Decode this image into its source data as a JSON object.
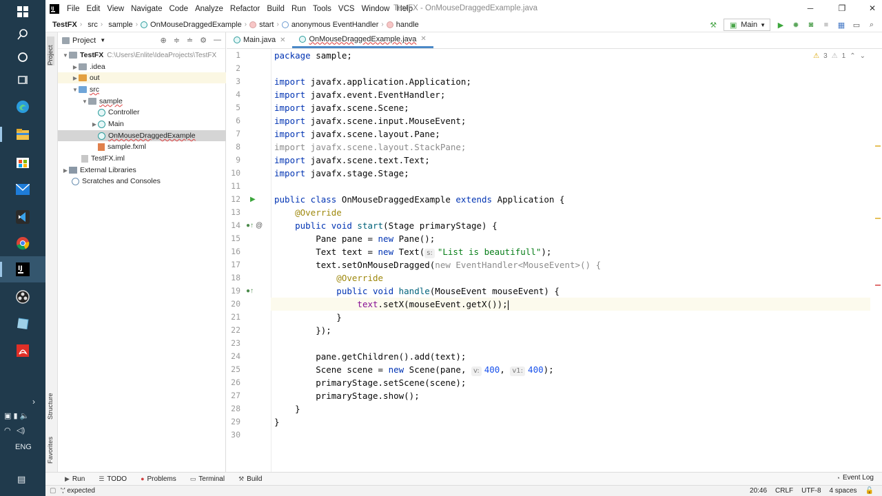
{
  "taskbar": {
    "language": "ENG"
  },
  "menu": {
    "items": [
      "File",
      "Edit",
      "View",
      "Navigate",
      "Code",
      "Analyze",
      "Refactor",
      "Build",
      "Run",
      "Tools",
      "VCS",
      "Window",
      "Help"
    ],
    "window_title": "TestFX - OnMouseDraggedExample.java"
  },
  "navbar": {
    "crumbs": [
      "TestFX",
      "src",
      "sample",
      "OnMouseDraggedExample",
      "start",
      "anonymous EventHandler",
      "handle"
    ],
    "run_config": "Main"
  },
  "left_strip": {
    "project_tab": "Project",
    "structure_tab": "Structure",
    "favorites_tab": "Favorites"
  },
  "project_panel": {
    "title": "Project",
    "tree": [
      {
        "label": "TestFX",
        "path": "C:\\Users\\Enlite\\IdeaProjects\\TestFX"
      },
      {
        "label": ".idea"
      },
      {
        "label": "out"
      },
      {
        "label": "src"
      },
      {
        "label": "sample"
      },
      {
        "label": "Controller"
      },
      {
        "label": "Main"
      },
      {
        "label": "OnMouseDraggedExample"
      },
      {
        "label": "sample.fxml"
      },
      {
        "label": "TestFX.iml"
      },
      {
        "label": "External Libraries"
      },
      {
        "label": "Scratches and Consoles"
      }
    ]
  },
  "editor": {
    "tabs": [
      "Main.java",
      "OnMouseDraggedExample.java"
    ],
    "inspections": {
      "warnings": "3",
      "weak": "1"
    },
    "hints": {
      "s": "s:",
      "v": "v:",
      "v1": "v1:"
    },
    "code": {
      "l1a": "package",
      "l1b": " sample;",
      "l3a": "import",
      "l3b": " javafx.application.Application;",
      "l4a": "import",
      "l4b": " javafx.event.EventHandler;",
      "l5a": "import",
      "l5b": " javafx.scene.Scene;",
      "l6a": "import",
      "l6b": " javafx.scene.input.MouseEvent;",
      "l7a": "import",
      "l7b": " javafx.scene.layout.Pane;",
      "l8": "import javafx.scene.layout.StackPane;",
      "l9a": "import",
      "l9b": " javafx.scene.text.Text;",
      "l10a": "import",
      "l10b": " javafx.stage.Stage;",
      "l12a": "public class",
      "l12b": " OnMouseDraggedExample ",
      "l12c": "extends",
      "l12d": " Application {",
      "l13": "    @Override",
      "l14a": "    public void",
      "l14b": " start",
      "l14c": "(Stage primaryStage) {",
      "l15a": "        Pane pane = ",
      "l15b": "new",
      "l15c": " Pane();",
      "l16a": "        Text text = ",
      "l16b": "new",
      "l16c": " Text(",
      "l16d": "\"List is beautifull\"",
      "l16e": ");",
      "l17a": "        text.setOnMouseDragged(",
      "l17b": "new EventHandler<MouseEvent>() {",
      "l18": "            @Override",
      "l19a": "            public void",
      "l19b": " handle",
      "l19c": "(MouseEvent mouseEvent) {",
      "l20a": "                ",
      "l20b": "text",
      "l20c": ".setX(mouseEvent.getX());",
      "l21": "            }",
      "l22": "        });",
      "l24": "        pane.getChildren().add(text);",
      "l25a": "        Scene scene = ",
      "l25b": "new",
      "l25c": " Scene(pane, ",
      "l25d": "400",
      "l25e": ", ",
      "l25f": "400",
      "l25g": ");",
      "l26": "        primaryStage.setScene(scene);",
      "l27": "        primaryStage.show();",
      "l28": "    }",
      "l29": "}"
    },
    "line_numbers": [
      "1",
      "2",
      "3",
      "4",
      "5",
      "6",
      "7",
      "8",
      "9",
      "10",
      "11",
      "12",
      "13",
      "14",
      "15",
      "16",
      "17",
      "18",
      "19",
      "20",
      "21",
      "22",
      "23",
      "24",
      "25",
      "26",
      "27",
      "28",
      "29",
      "30"
    ]
  },
  "bottom_tools": {
    "run": "Run",
    "todo": "TODO",
    "problems": "Problems",
    "terminal": "Terminal",
    "build": "Build",
    "event_log": "Event Log"
  },
  "status": {
    "message": "';' expected",
    "position": "20:46",
    "line_sep": "CRLF",
    "encoding": "UTF-8",
    "indent": "4 spaces"
  }
}
